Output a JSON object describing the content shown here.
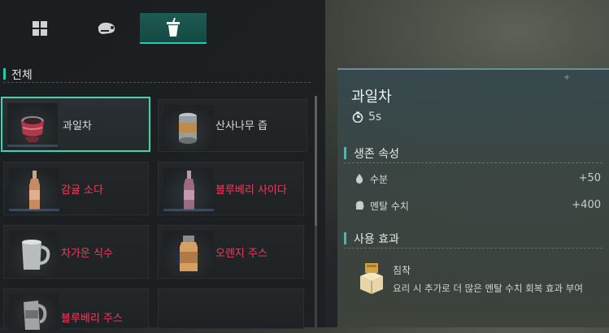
{
  "tabs": [
    {
      "icon": "grid-icon"
    },
    {
      "icon": "meat-icon"
    },
    {
      "icon": "drink-cup-icon",
      "active": true
    }
  ],
  "category": {
    "title": "전체"
  },
  "items": [
    {
      "label": "과일차",
      "icon": "teapot-icon",
      "highlight": false,
      "selected": true
    },
    {
      "label": "산사나무 즙",
      "icon": "can-icon",
      "highlight": false
    },
    {
      "label": "감귤 소다",
      "icon": "bottle-icon",
      "highlight": true
    },
    {
      "label": "블루베리 사이다",
      "icon": "bottle-icon",
      "highlight": true
    },
    {
      "label": "차가운 식수",
      "icon": "mug-icon",
      "highlight": true
    },
    {
      "label": "오렌지 주스",
      "icon": "jar-icon",
      "highlight": true
    },
    {
      "label": "블루베리 주스",
      "icon": "pitcher-icon",
      "highlight": true
    },
    {
      "label": "",
      "icon": "",
      "highlight": false
    }
  ],
  "detail": {
    "title": "과일차",
    "time": "5s",
    "survival_section": "생존 속성",
    "stats": [
      {
        "name": "수분",
        "value": "+50",
        "icon": "water-drop-icon"
      },
      {
        "name": "멘탈 수치",
        "value": "+400",
        "icon": "head-icon"
      }
    ],
    "use_section": "사용 효과",
    "effect": {
      "name": "침착",
      "description": "요리 시 추가로 더 많은 멘탈 수치 회복 효과 부여",
      "icon": "crate-icon"
    }
  },
  "colors": {
    "accent": "#2fc7ac",
    "highlight_text": "#e8405a"
  }
}
